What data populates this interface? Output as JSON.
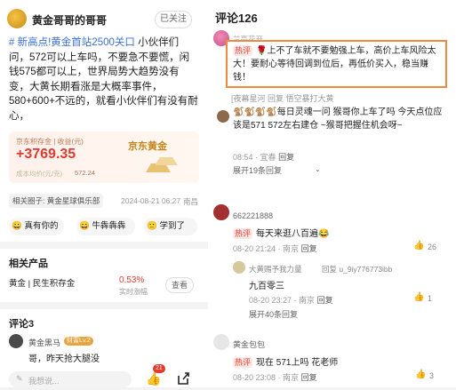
{
  "post": {
    "author": "黄金哥哥的哥哥",
    "follow_state": "已关注",
    "body_tag": "# 新高点!",
    "body_link": "黄金首站2500关口",
    "body_text": " 小伙伴们问，572可以上车吗，不要急不要慌，闲钱575都可以上，世界局势大趋势没有变，大黄长期看涨是大概率事件，580+600+不远的，就看小伙伴们有没有耐心，",
    "holding": {
      "label": "京东积存金 | 收益(元)",
      "value": "+3769.35",
      "cost_label": "成本均价(元/克)",
      "cost_value": "572.24",
      "brand": "京东黄金"
    },
    "circle_label": "相关圈子: 黄金星球俱乐部",
    "timestamp": "2024-08-21 06:27",
    "location": "南昌",
    "reactions": [
      {
        "emoji": "😀",
        "label": "真有你的"
      },
      {
        "emoji": "😄",
        "label": "牛犇犇犇"
      },
      {
        "emoji": "🙂",
        "label": "学到了"
      }
    ]
  },
  "related": {
    "title": "相关产品",
    "product_name": "黄金 | 民生积存金",
    "rate": "0.53%",
    "rate_label": "实时涨幅",
    "view_button": "查看"
  },
  "comments_left": {
    "title": "评论3",
    "user": "黄金黑马",
    "badge": "财富Lv.2",
    "text": "哥，昨天抢大腿没"
  },
  "bottom_bar": {
    "input_placeholder": "我想说...",
    "like_count": "21"
  },
  "comments_right": {
    "title": "评论126",
    "c1": {
      "user": "兰亭花开",
      "hot": "热评",
      "text": "🌹上不了车就不要勉强上车，高价上车风险太大！要耐心等待回调到位后，再低价买入，稳当赚钱！"
    },
    "c1_reply_line": "[夜幕星河  回复  悟空暴打大黄",
    "c2": {
      "text": "🐒🐒🐒🐒每日灵魂一问 猴哥你上车了吗 今天点位应该是571 572左右建仓 ~猴哥把握住机会呀~",
      "time": "08:54",
      "place": "宜春",
      "reply": "回复",
      "expand": "展开19条回复"
    },
    "c3": {
      "user": "662221888",
      "hot": "热评",
      "text": "每天来逛八百遍😂",
      "time": "08-20 21:24",
      "place": "南京",
      "reply": "回复",
      "likes": "26"
    },
    "c4": {
      "user": "大黄赐予我力量",
      "reply_to": "回复  u_9iy776773ibb",
      "text": "九百零三",
      "time": "08-20 23:27",
      "place": "南京",
      "reply": "回复",
      "likes": "1",
      "expand": "展开40条回复"
    },
    "c5": {
      "user": "黄金包包",
      "hot": "热评",
      "text": "现在 571上吗 花老师",
      "time": "08-20 23:08",
      "place": "南京",
      "reply": "回复",
      "likes": "3"
    }
  },
  "colors": {
    "red": "#e23b2e",
    "link": "#3a6fd8",
    "highlight_border": "#f08a3c"
  }
}
